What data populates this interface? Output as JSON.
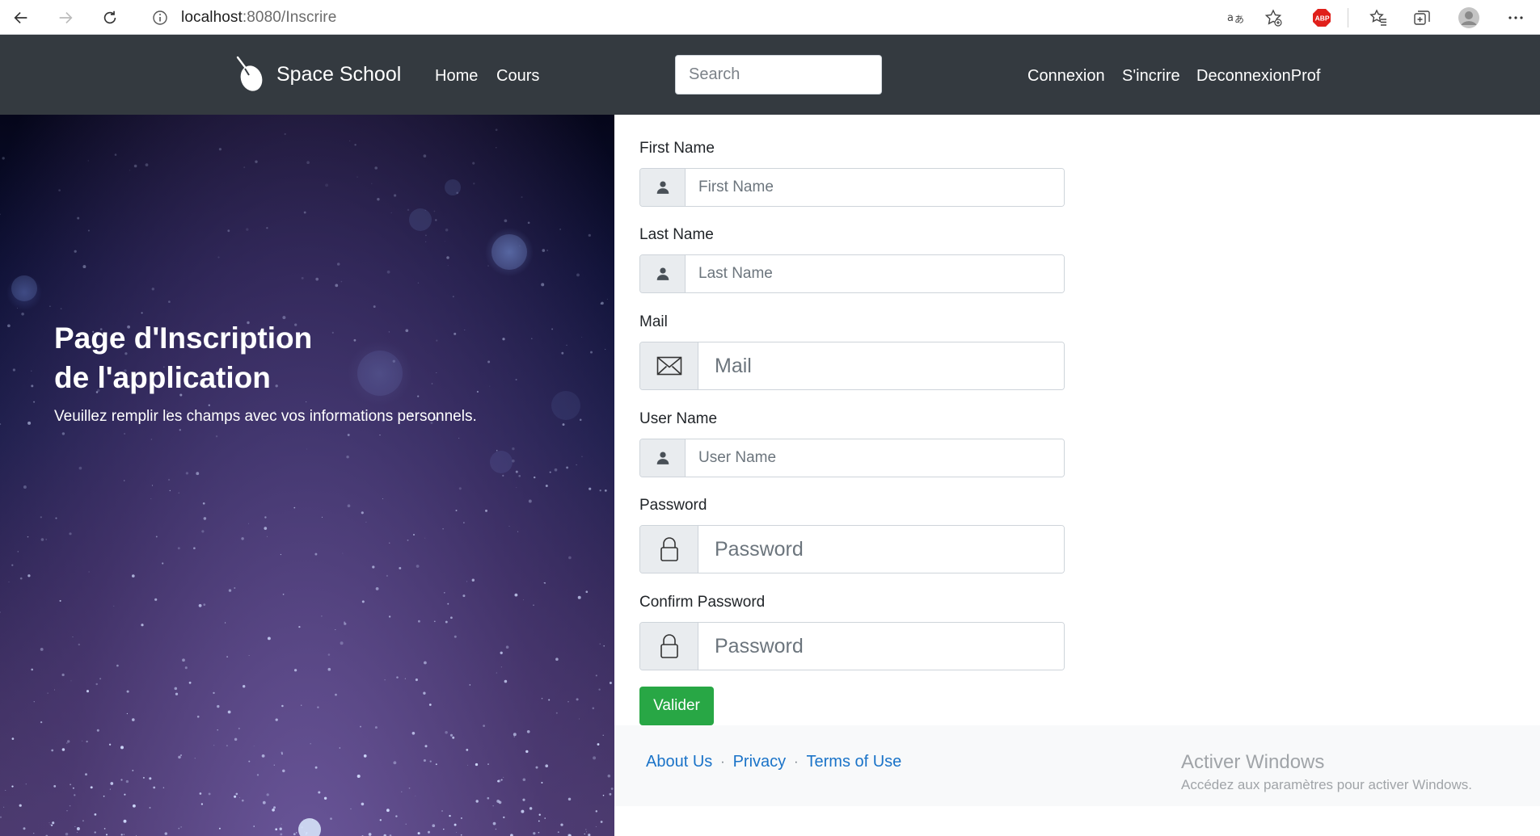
{
  "browser": {
    "url_host": "localhost",
    "url_path": ":8080/Inscrire"
  },
  "navbar": {
    "brand": "Space School",
    "links": {
      "home": "Home",
      "cours": "Cours",
      "connexion": "Connexion",
      "sinscrire": "S'incrire",
      "deconnexion": "DeconnexionProf"
    },
    "search_placeholder": "Search"
  },
  "hero": {
    "title_line1": "Page d'Inscription",
    "title_line2": "de l'application",
    "subtitle": "Veuillez remplir les champs avec vos informations personnels."
  },
  "form": {
    "first_name": {
      "label": "First Name",
      "placeholder": "First Name"
    },
    "last_name": {
      "label": "Last Name",
      "placeholder": "Last Name"
    },
    "mail": {
      "label": "Mail",
      "placeholder": "Mail"
    },
    "user_name": {
      "label": "User Name",
      "placeholder": "User Name"
    },
    "password": {
      "label": "Password",
      "placeholder": "Password"
    },
    "confirm_password": {
      "label": "Confirm Password",
      "placeholder": "Password"
    },
    "submit": "Valider"
  },
  "footer": {
    "about": "About Us",
    "privacy": "Privacy",
    "terms": "Terms of Use",
    "separator": "·"
  },
  "windows_watermark": {
    "title": "Activer Windows",
    "subtitle": "Accédez aux paramètres pour activer Windows."
  },
  "colors": {
    "navbar": "#343a40",
    "submit": "#28a745",
    "link": "#1a73c8",
    "footer_bg": "#f8f9fa"
  },
  "icons": {
    "user": "user-icon",
    "mail": "envelope-icon",
    "password": "lock-icon",
    "brand": "mouse-logo-icon"
  }
}
